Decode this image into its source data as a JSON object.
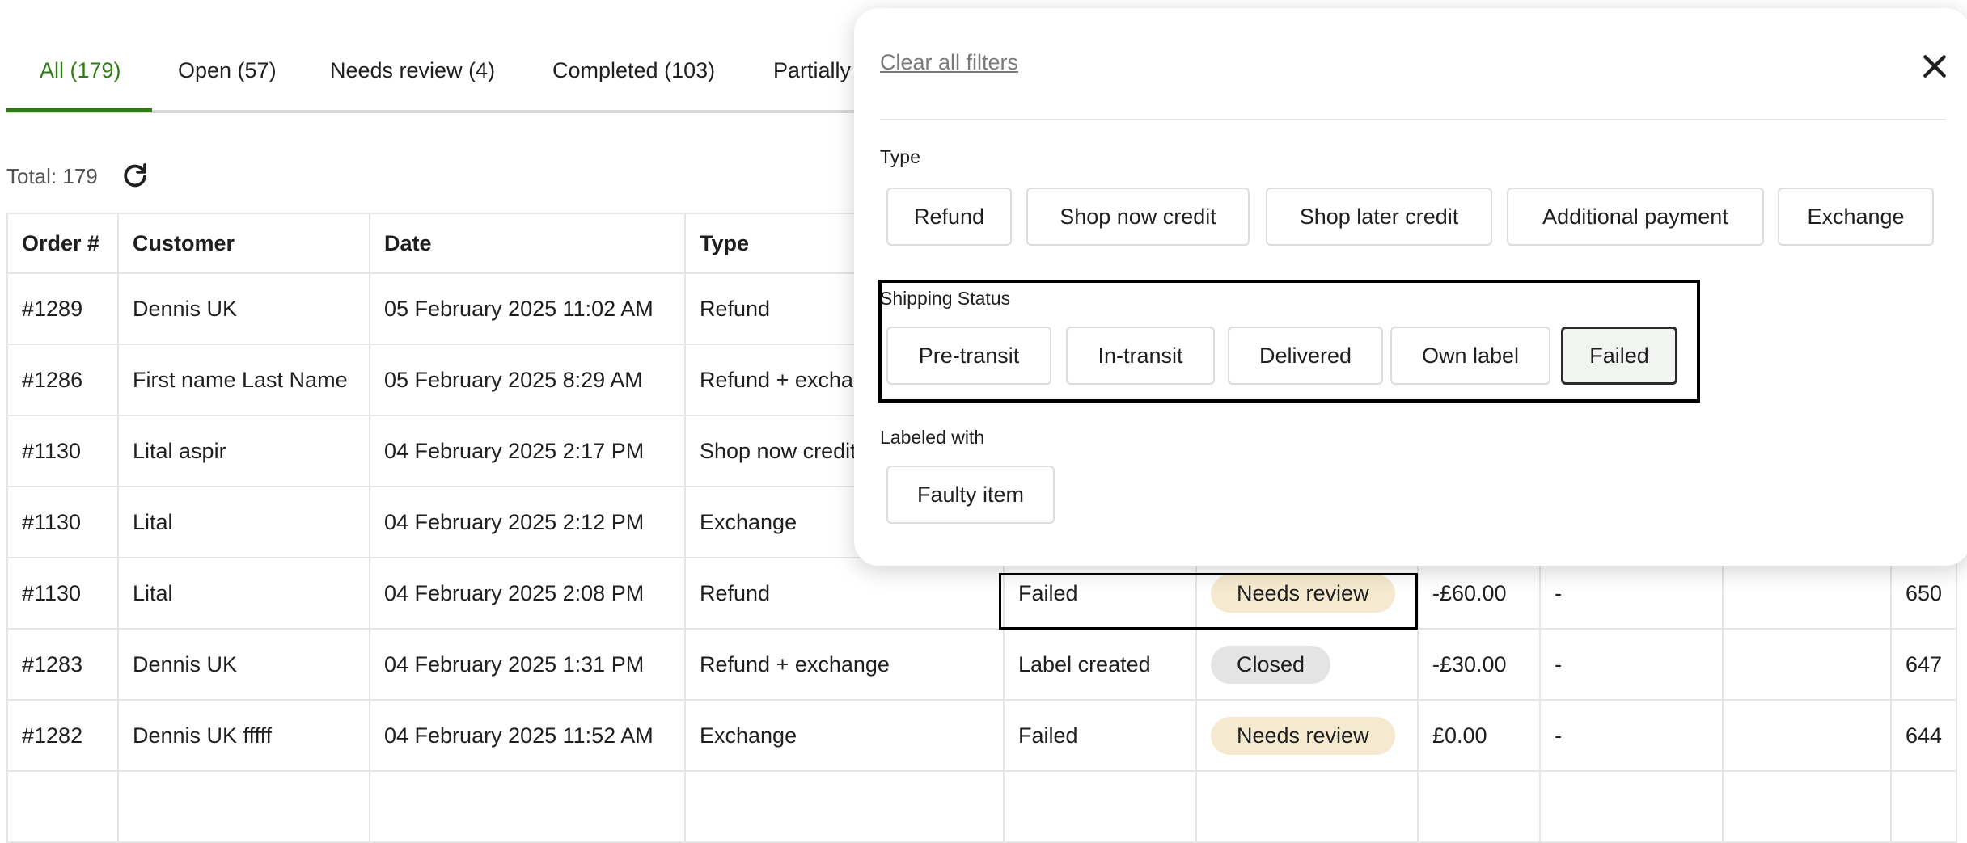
{
  "tabs": [
    {
      "label": "All (179)"
    },
    {
      "label": "Open (57)"
    },
    {
      "label": "Needs review (4)"
    },
    {
      "label": "Completed (103)"
    },
    {
      "label": "Partially"
    }
  ],
  "total_label": "Total: 179",
  "table": {
    "headers": [
      "Order #",
      "Customer",
      "Date",
      "Type"
    ],
    "rows": [
      {
        "order": "#1289",
        "customer": "Dennis UK",
        "date": "05 February 2025 11:02 AM",
        "type": "Refund"
      },
      {
        "order": "#1286",
        "customer": "First name Last Name",
        "date": "05 February 2025 8:29 AM",
        "type": "Refund + exchange"
      },
      {
        "order": "#1130",
        "customer": "Lital aspir",
        "date": "04 February 2025 2:17 PM",
        "type": "Shop now credit"
      },
      {
        "order": "#1130",
        "customer": "Lital",
        "date": "04 February 2025 2:12 PM",
        "type": "Exchange"
      },
      {
        "order": "#1130",
        "customer": "Lital",
        "date": "04 February 2025 2:08 PM",
        "type": "Refund",
        "shipping": "Failed",
        "status": "Needs review",
        "amount": "-£60.00",
        "dash": "-",
        "last": "650"
      },
      {
        "order": "#1283",
        "customer": "Dennis UK",
        "date": "04 February 2025 1:31 PM",
        "type": "Refund + exchange",
        "shipping": "Label created",
        "status": "Closed",
        "amount": "-£30.00",
        "dash": "-",
        "last": "647"
      },
      {
        "order": "#1282",
        "customer": "Dennis UK fffff",
        "date": "04 February 2025 11:52 AM",
        "type": "Exchange",
        "shipping": "Failed",
        "status": "Needs review",
        "amount": "£0.00",
        "dash": "-",
        "last": "644"
      }
    ]
  },
  "filters": {
    "clear_label": "Clear all filters",
    "type_label": "Type",
    "type_options": [
      "Refund",
      "Shop now credit",
      "Shop later credit",
      "Additional payment",
      "Exchange"
    ],
    "shipping_label": "Shipping Status",
    "shipping_options": [
      "Pre-transit",
      "In-transit",
      "Delivered",
      "Own label",
      "Failed"
    ],
    "shipping_selected": "Failed",
    "labeled_label": "Labeled with",
    "labeled_options": [
      "Faulty item"
    ]
  },
  "colors": {
    "accent": "#2f7d14",
    "review_badge": "#f5ead0",
    "closed_badge": "#e4e4e4"
  }
}
